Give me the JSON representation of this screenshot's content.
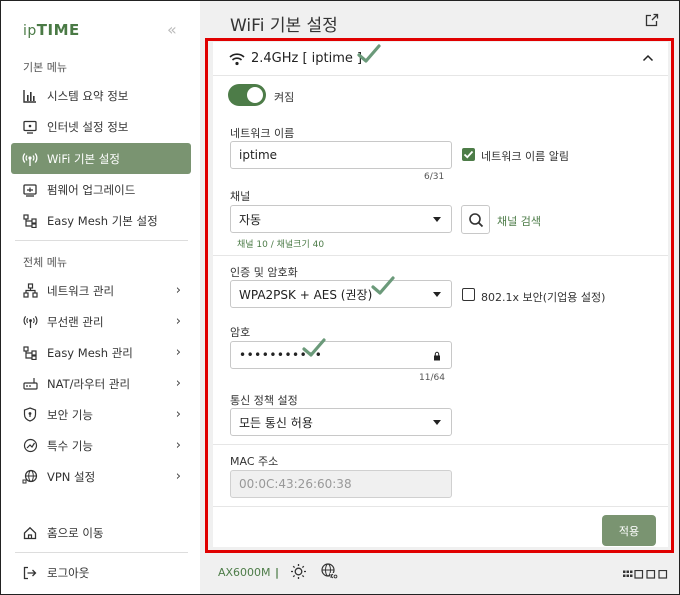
{
  "brand": {
    "logo_prefix": "ip",
    "logo_main": "TIME"
  },
  "sidebar": {
    "basic_menu_label": "기본 메뉴",
    "basic_items": [
      {
        "label": "시스템 요약 정보",
        "icon": "bar-chart-icon"
      },
      {
        "label": "인터넷 설정 정보",
        "icon": "monitor-icon"
      },
      {
        "label": "WiFi 기본 설정",
        "icon": "wifi-broadcast-icon",
        "active": true
      },
      {
        "label": "펌웨어 업그레이드",
        "icon": "firmware-icon"
      },
      {
        "label": "Easy Mesh 기본 설정",
        "icon": "mesh-icon"
      }
    ],
    "all_menu_label": "전체 메뉴",
    "all_items": [
      {
        "label": "네트워크 관리",
        "icon": "network-icon"
      },
      {
        "label": "무선랜 관리",
        "icon": "wireless-icon"
      },
      {
        "label": "Easy Mesh 관리",
        "icon": "mesh-icon"
      },
      {
        "label": "NAT/라우터 관리",
        "icon": "router-icon"
      },
      {
        "label": "보안 기능",
        "icon": "shield-icon"
      },
      {
        "label": "특수 기능",
        "icon": "special-icon"
      },
      {
        "label": "VPN 설정",
        "icon": "globe-network-icon"
      }
    ],
    "home_label": "홈으로 이동",
    "logout_label": "로그아웃"
  },
  "main": {
    "title": "WiFi 기본 설정",
    "card_title": "2.4GHz [ iptime ]",
    "toggle_label": "켜짐",
    "network_name_label": "네트워크 이름",
    "network_name_value": "iptime",
    "network_name_counter": "6/31",
    "broadcast_name_label": "네트워크 이름 알림",
    "channel_label": "채널",
    "channel_value": "자동",
    "channel_search_label": "채널 검색",
    "channel_hint": "채널 10 / 채널크기 40",
    "auth_label": "인증 및 암호화",
    "auth_value": "WPA2PSK + AES (권장)",
    "enterprise_label": "802.1x 보안(기업용 설정)",
    "password_label": "암호",
    "password_value": "•••••••••••",
    "password_counter": "11/64",
    "policy_label": "통신 정책 설정",
    "policy_value": "모든 통신 허용",
    "mac_label": "MAC 주소",
    "mac_value": "00:0C:43:26:60:38",
    "apply_label": "적용"
  },
  "footer": {
    "model": "AX6000M",
    "separator": "|"
  },
  "colors": {
    "accent": "#4d7c48",
    "active_bg": "#7a9471",
    "highlight": "#e00000",
    "checkmark": "#6b9a7a"
  }
}
